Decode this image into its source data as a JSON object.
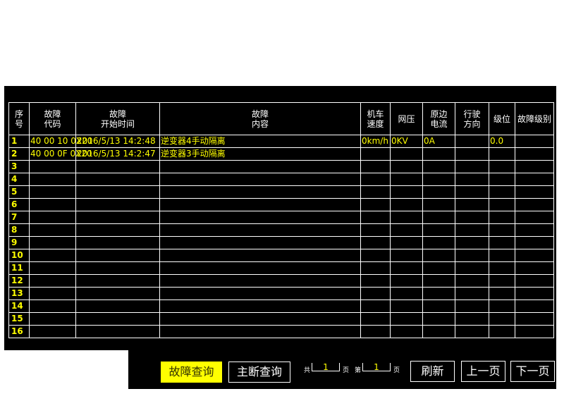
{
  "table": {
    "headers": [
      "序\n号",
      "故障\n代码",
      "故障\n开始时间",
      "故障\n内容",
      "机车\n速度",
      "网压",
      "原边\n电流",
      "行驶\n方向",
      "级位",
      "故障级别"
    ],
    "rows": [
      [
        "1",
        "40 00 10 0X20",
        "2016/5/13 14:2:48",
        "逆变器4手动隔离",
        "0km/h",
        "0KV",
        "0A",
        "",
        "0.0",
        ""
      ],
      [
        "2",
        "40 00 0F 0X20",
        "2016/5/13 14:2:47",
        "逆变器3手动隔离",
        "",
        "",
        "",
        "",
        "",
        ""
      ],
      [
        "3",
        "",
        "",
        "",
        "",
        "",
        "",
        "",
        "",
        ""
      ],
      [
        "4",
        "",
        "",
        "",
        "",
        "",
        "",
        "",
        "",
        ""
      ],
      [
        "5",
        "",
        "",
        "",
        "",
        "",
        "",
        "",
        "",
        ""
      ],
      [
        "6",
        "",
        "",
        "",
        "",
        "",
        "",
        "",
        "",
        ""
      ],
      [
        "7",
        "",
        "",
        "",
        "",
        "",
        "",
        "",
        "",
        ""
      ],
      [
        "8",
        "",
        "",
        "",
        "",
        "",
        "",
        "",
        "",
        ""
      ],
      [
        "9",
        "",
        "",
        "",
        "",
        "",
        "",
        "",
        "",
        ""
      ],
      [
        "10",
        "",
        "",
        "",
        "",
        "",
        "",
        "",
        "",
        ""
      ],
      [
        "11",
        "",
        "",
        "",
        "",
        "",
        "",
        "",
        "",
        ""
      ],
      [
        "12",
        "",
        "",
        "",
        "",
        "",
        "",
        "",
        "",
        ""
      ],
      [
        "13",
        "",
        "",
        "",
        "",
        "",
        "",
        "",
        "",
        ""
      ],
      [
        "14",
        "",
        "",
        "",
        "",
        "",
        "",
        "",
        "",
        ""
      ],
      [
        "15",
        "",
        "",
        "",
        "",
        "",
        "",
        "",
        "",
        ""
      ],
      [
        "16",
        "",
        "",
        "",
        "",
        "",
        "",
        "",
        "",
        ""
      ]
    ]
  },
  "toolbar": {
    "fault_query_label": "故障查询",
    "main_break_query_label": "主断查询",
    "total_prefix": "共",
    "total_pages": "1",
    "page_suffix_1": "页",
    "current_prefix": "第",
    "current_page": "1",
    "page_suffix_2": "页",
    "refresh_label": "刷新",
    "prev_label": "上一页",
    "next_label": "下一页"
  },
  "colors": {
    "background": "#000000",
    "text_primary": "#ffffff",
    "text_data": "#ffff00",
    "active_button": "#ffff00"
  }
}
